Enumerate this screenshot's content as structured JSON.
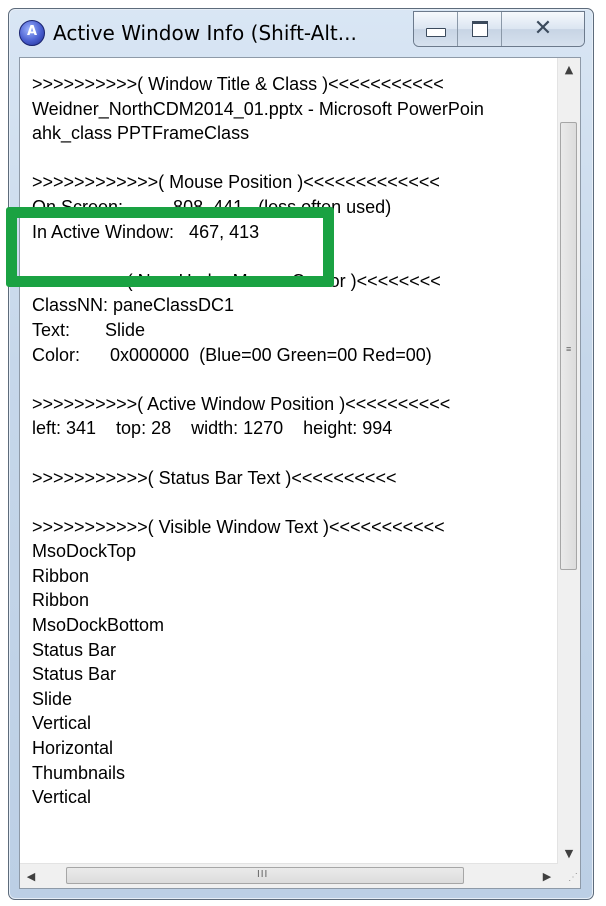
{
  "window": {
    "title": "Active Window Info (Shift-Alt...",
    "accent_highlight_color": "#1aa242"
  },
  "icons": {
    "app": "autohotkey-icon",
    "minimize": "minimize-icon",
    "maximize": "maximize-icon",
    "close": "close-icon"
  },
  "caption": {
    "close_glyph": "✕"
  },
  "lines": [
    ">>>>>>>>>>( Window Title & Class )<<<<<<<<<<<",
    "Weidner_NorthCDM2014_01.pptx - Microsoft PowerPoin",
    "ahk_class PPTFrameClass",
    "",
    ">>>>>>>>>>>>( Mouse Position )<<<<<<<<<<<<<",
    "On Screen:          808, 441   (less often used)",
    "In Active Window:   467, 413",
    "",
    ">>>>>>>>>( Now Under Mouse Cursor )<<<<<<<<",
    "ClassNN: paneClassDC1",
    "Text:       Slide",
    "Color:      0x000000  (Blue=00 Green=00 Red=00)",
    "",
    ">>>>>>>>>>( Active Window Position )<<<<<<<<<<",
    "left: 341    top: 28    width: 1270    height: 994",
    "",
    ">>>>>>>>>>>( Status Bar Text )<<<<<<<<<<",
    "",
    ">>>>>>>>>>>( Visible Window Text )<<<<<<<<<<<",
    "MsoDockTop",
    "Ribbon",
    "Ribbon",
    "MsoDockBottom",
    "Status Bar",
    "Status Bar",
    "Slide",
    "Vertical",
    "Horizontal",
    "Thumbnails",
    "Vertical"
  ],
  "scroll": {
    "up_glyph": "▲",
    "down_glyph": "▼",
    "left_glyph": "◀",
    "right_glyph": "▶",
    "grip_glyph": "III",
    "size_grip_glyph": "⋰"
  }
}
